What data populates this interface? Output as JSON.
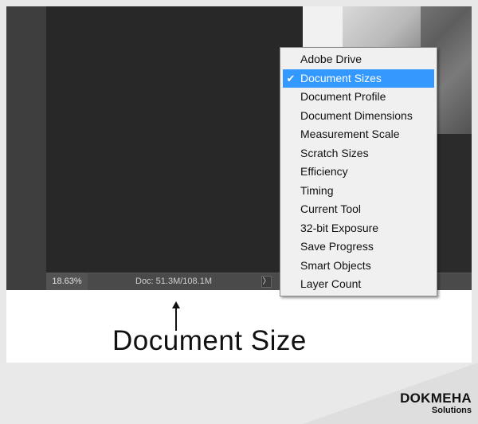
{
  "status_bar": {
    "zoom": "18.63%",
    "doc_info": "Doc: 51.3M/108.1M",
    "expand_glyph": "〉"
  },
  "menu": {
    "items": [
      {
        "label": "Adobe Drive",
        "checked": false
      },
      {
        "label": "Document Sizes",
        "checked": true
      },
      {
        "label": "Document Profile",
        "checked": false
      },
      {
        "label": "Document Dimensions",
        "checked": false
      },
      {
        "label": "Measurement Scale",
        "checked": false
      },
      {
        "label": "Scratch Sizes",
        "checked": false
      },
      {
        "label": "Efficiency",
        "checked": false
      },
      {
        "label": "Timing",
        "checked": false
      },
      {
        "label": "Current Tool",
        "checked": false
      },
      {
        "label": "32-bit Exposure",
        "checked": false
      },
      {
        "label": "Save Progress",
        "checked": false
      },
      {
        "label": "Smart Objects",
        "checked": false
      },
      {
        "label": "Layer Count",
        "checked": false
      }
    ],
    "check_glyph": "✔",
    "highlight_color": "#3399ff"
  },
  "caption": "Document Size",
  "brand": {
    "main": "DOKMEHA",
    "sub": "Solutions"
  }
}
